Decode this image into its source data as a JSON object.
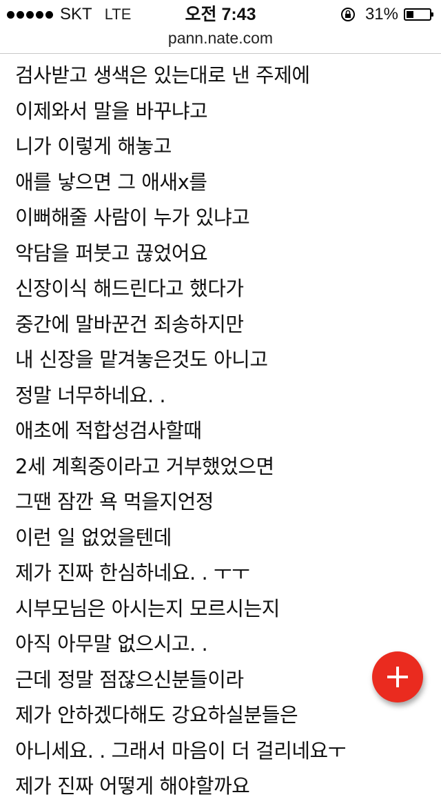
{
  "status_bar": {
    "carrier": "SKT",
    "network": "LTE",
    "time": "오전 7:43",
    "battery_percent_label": "31%",
    "battery_level": 0.31,
    "icons": [
      "signal-dots-icon",
      "orientation-lock-icon",
      "battery-icon"
    ]
  },
  "browser": {
    "url": "pann.nate.com"
  },
  "article": {
    "lines": [
      "검사받고 생색은 있는대로 낸 주제에",
      "이제와서 말을 바꾸냐고",
      "니가 이렇게 해놓고",
      "애를 낳으면 그 애새x를",
      "이뻐해줄 사람이 누가 있냐고",
      "악담을 퍼붓고 끊었어요",
      "신장이식 해드린다고 했다가",
      "중간에 말바꾼건 죄송하지만",
      "내 신장을 맡겨놓은것도 아니고",
      "정말 너무하네요. .",
      "애초에 적합성검사할때",
      "2세 계획중이라고 거부했었으면",
      "그땐 잠깐 욕 먹을지언정",
      "이런 일 없었을텐데",
      "제가 진짜 한심하네요. . ㅜㅜ",
      "시부모님은 아시는지 모르시는지",
      "아직 아무말 없으시고. .",
      "근데 정말 점잖으신분들이라",
      "제가 안하겠다해도 강요하실분들은",
      "아니세요. . 그래서 마음이 더 걸리네요ㅜ",
      "제가 진짜 어떻게 해야할까요"
    ]
  },
  "fab": {
    "icon": "plus-icon",
    "color": "#ea2b1f"
  }
}
